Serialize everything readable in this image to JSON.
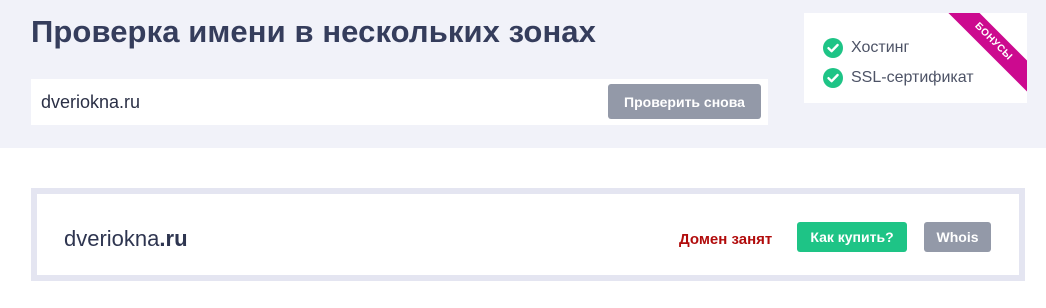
{
  "header": {
    "title": "Проверка имени в нескольких зонах"
  },
  "search": {
    "value": "dveriokna.ru",
    "button_label": "Проверить снова"
  },
  "bonus": {
    "ribbon_label": "БОНУСЫ",
    "ribbon_color": "#cc0a8f",
    "check_color": "#1ec486",
    "items": [
      {
        "icon": "check-circle-icon",
        "label": "Хостинг"
      },
      {
        "icon": "check-circle-icon",
        "label": "SSL-сертификат"
      }
    ]
  },
  "result": {
    "domain_base": "dveriokna",
    "domain_zone": ".ru",
    "status": "Домен занят",
    "status_color": "#b10b0b",
    "buy_button_label": "Как купить?",
    "whois_button_label": "Whois"
  }
}
